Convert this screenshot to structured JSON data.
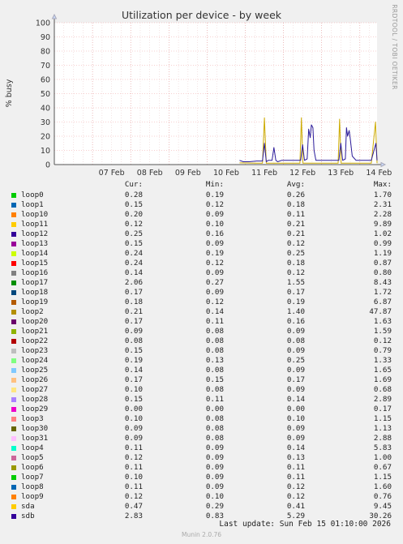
{
  "chart_data": {
    "type": "line",
    "title": "Utilization per device - by week",
    "ylabel": "% busy",
    "ylim": [
      0,
      100
    ],
    "yticks": [
      0,
      10,
      20,
      30,
      40,
      50,
      60,
      70,
      80,
      90,
      100
    ],
    "xticks": [
      "07 Feb",
      "08 Feb",
      "09 Feb",
      "10 Feb",
      "11 Feb",
      "12 Feb",
      "13 Feb",
      "14 Feb"
    ],
    "xrange_days": [
      6.0,
      14.45
    ],
    "side_label": "RRDTOOL / TOBI OETIKER",
    "grid": true,
    "series": [
      {
        "name": "sda",
        "color": "#ccaa00",
        "x": [
          10.85,
          11.3,
          11.45,
          11.5,
          11.55,
          11.6,
          11.7,
          11.9,
          12.1,
          12.3,
          12.43,
          12.47,
          12.51,
          12.55,
          12.7,
          12.9,
          13.1,
          13.3,
          13.43,
          13.47,
          13.51,
          13.55,
          13.7,
          13.9,
          14.1,
          14.3,
          14.41,
          14.45
        ],
        "y": [
          1.2,
          1,
          1,
          33,
          1,
          1,
          1,
          1,
          1,
          1,
          1,
          33,
          1,
          1,
          1,
          1,
          1,
          1,
          1,
          32,
          1,
          1,
          1,
          1,
          1,
          1,
          30,
          1
        ]
      },
      {
        "name": "sdb",
        "color": "#2a1a99",
        "x": [
          10.85,
          10.95,
          11.1,
          11.3,
          11.45,
          11.5,
          11.55,
          11.6,
          11.7,
          11.75,
          11.8,
          11.85,
          11.95,
          12.1,
          12.3,
          12.45,
          12.5,
          12.55,
          12.62,
          12.66,
          12.7,
          12.73,
          12.77,
          12.8,
          12.85,
          12.95,
          13.1,
          13.3,
          13.45,
          13.5,
          13.55,
          13.62,
          13.65,
          13.68,
          13.72,
          13.75,
          13.8,
          13.9,
          14.1,
          14.3,
          14.42,
          14.45
        ],
        "y": [
          3,
          2,
          2,
          2.5,
          2.5,
          15,
          2,
          3,
          3,
          12,
          3,
          2,
          3,
          3,
          3,
          3,
          14,
          3,
          4,
          25,
          19,
          28,
          26,
          10,
          3,
          3,
          3,
          3,
          3,
          15,
          3,
          4,
          26,
          20,
          24,
          18,
          6,
          3,
          3,
          3,
          15,
          3
        ]
      }
    ],
    "legend_headers": {
      "cur": "Cur:",
      "min": "Min:",
      "avg": "Avg:",
      "max": "Max:"
    },
    "legend": [
      {
        "name": "loop0",
        "color": "#00cc00",
        "cur": "0.28",
        "min": "0.19",
        "avg": "0.26",
        "max": "1.70"
      },
      {
        "name": "loop1",
        "color": "#0066b3",
        "cur": "0.15",
        "min": "0.12",
        "avg": "0.18",
        "max": "2.31"
      },
      {
        "name": "loop10",
        "color": "#ff8000",
        "cur": "0.20",
        "min": "0.09",
        "avg": "0.11",
        "max": "2.28"
      },
      {
        "name": "loop11",
        "color": "#ffcc00",
        "cur": "0.12",
        "min": "0.10",
        "avg": "0.21",
        "max": "9.89"
      },
      {
        "name": "loop12",
        "color": "#330099",
        "cur": "0.25",
        "min": "0.16",
        "avg": "0.21",
        "max": "1.02"
      },
      {
        "name": "loop13",
        "color": "#990099",
        "cur": "0.15",
        "min": "0.09",
        "avg": "0.12",
        "max": "0.99"
      },
      {
        "name": "loop14",
        "color": "#ccff00",
        "cur": "0.24",
        "min": "0.19",
        "avg": "0.25",
        "max": "1.19"
      },
      {
        "name": "loop15",
        "color": "#ff0000",
        "cur": "0.24",
        "min": "0.12",
        "avg": "0.18",
        "max": "0.87"
      },
      {
        "name": "loop16",
        "color": "#808080",
        "cur": "0.14",
        "min": "0.09",
        "avg": "0.12",
        "max": "0.80"
      },
      {
        "name": "loop17",
        "color": "#008f00",
        "cur": "2.06",
        "min": "0.27",
        "avg": "1.55",
        "max": "8.43"
      },
      {
        "name": "loop18",
        "color": "#00487d",
        "cur": "0.17",
        "min": "0.09",
        "avg": "0.17",
        "max": "1.72"
      },
      {
        "name": "loop19",
        "color": "#b35a00",
        "cur": "0.18",
        "min": "0.12",
        "avg": "0.19",
        "max": "6.87"
      },
      {
        "name": "loop2",
        "color": "#b38f00",
        "cur": "0.21",
        "min": "0.14",
        "avg": "1.40",
        "max": "47.87"
      },
      {
        "name": "loop20",
        "color": "#6b006b",
        "cur": "0.17",
        "min": "0.11",
        "avg": "0.16",
        "max": "1.63"
      },
      {
        "name": "loop21",
        "color": "#8fb300",
        "cur": "0.09",
        "min": "0.08",
        "avg": "0.09",
        "max": "1.59"
      },
      {
        "name": "loop22",
        "color": "#b30000",
        "cur": "0.08",
        "min": "0.08",
        "avg": "0.08",
        "max": "0.12"
      },
      {
        "name": "loop23",
        "color": "#bebebe",
        "cur": "0.15",
        "min": "0.08",
        "avg": "0.09",
        "max": "0.79"
      },
      {
        "name": "loop24",
        "color": "#80ff80",
        "cur": "0.19",
        "min": "0.13",
        "avg": "0.25",
        "max": "1.33"
      },
      {
        "name": "loop25",
        "color": "#80c9ff",
        "cur": "0.14",
        "min": "0.08",
        "avg": "0.09",
        "max": "1.65"
      },
      {
        "name": "loop26",
        "color": "#ffc080",
        "cur": "0.17",
        "min": "0.15",
        "avg": "0.17",
        "max": "1.69"
      },
      {
        "name": "loop27",
        "color": "#ffe680",
        "cur": "0.10",
        "min": "0.08",
        "avg": "0.09",
        "max": "0.68"
      },
      {
        "name": "loop28",
        "color": "#aa80ff",
        "cur": "0.15",
        "min": "0.11",
        "avg": "0.14",
        "max": "2.89"
      },
      {
        "name": "loop29",
        "color": "#ee00cc",
        "cur": "0.00",
        "min": "0.00",
        "avg": "0.00",
        "max": "0.17"
      },
      {
        "name": "loop3",
        "color": "#ff8080",
        "cur": "0.10",
        "min": "0.08",
        "avg": "0.10",
        "max": "1.15"
      },
      {
        "name": "loop30",
        "color": "#666600",
        "cur": "0.09",
        "min": "0.08",
        "avg": "0.09",
        "max": "1.13"
      },
      {
        "name": "loop31",
        "color": "#ffbfff",
        "cur": "0.09",
        "min": "0.08",
        "avg": "0.09",
        "max": "2.88"
      },
      {
        "name": "loop4",
        "color": "#00ffcc",
        "cur": "0.11",
        "min": "0.09",
        "avg": "0.14",
        "max": "5.83"
      },
      {
        "name": "loop5",
        "color": "#cc6699",
        "cur": "0.12",
        "min": "0.09",
        "avg": "0.13",
        "max": "1.00"
      },
      {
        "name": "loop6",
        "color": "#999900",
        "cur": "0.11",
        "min": "0.09",
        "avg": "0.11",
        "max": "0.67"
      },
      {
        "name": "loop7",
        "color": "#00cc00",
        "cur": "0.10",
        "min": "0.09",
        "avg": "0.11",
        "max": "1.15"
      },
      {
        "name": "loop8",
        "color": "#0066b3",
        "cur": "0.11",
        "min": "0.09",
        "avg": "0.12",
        "max": "1.60"
      },
      {
        "name": "loop9",
        "color": "#ff8000",
        "cur": "0.12",
        "min": "0.10",
        "avg": "0.12",
        "max": "0.76"
      },
      {
        "name": "sda",
        "color": "#ffcc00",
        "cur": "0.47",
        "min": "0.29",
        "avg": "0.41",
        "max": "9.45"
      },
      {
        "name": "sdb",
        "color": "#330099",
        "cur": "2.83",
        "min": "0.83",
        "avg": "5.29",
        "max": "30.26"
      }
    ],
    "footer": {
      "last_update": "Last update: Sun Feb 15 01:10:00 2026",
      "generator": "Munin 2.0.76"
    }
  }
}
